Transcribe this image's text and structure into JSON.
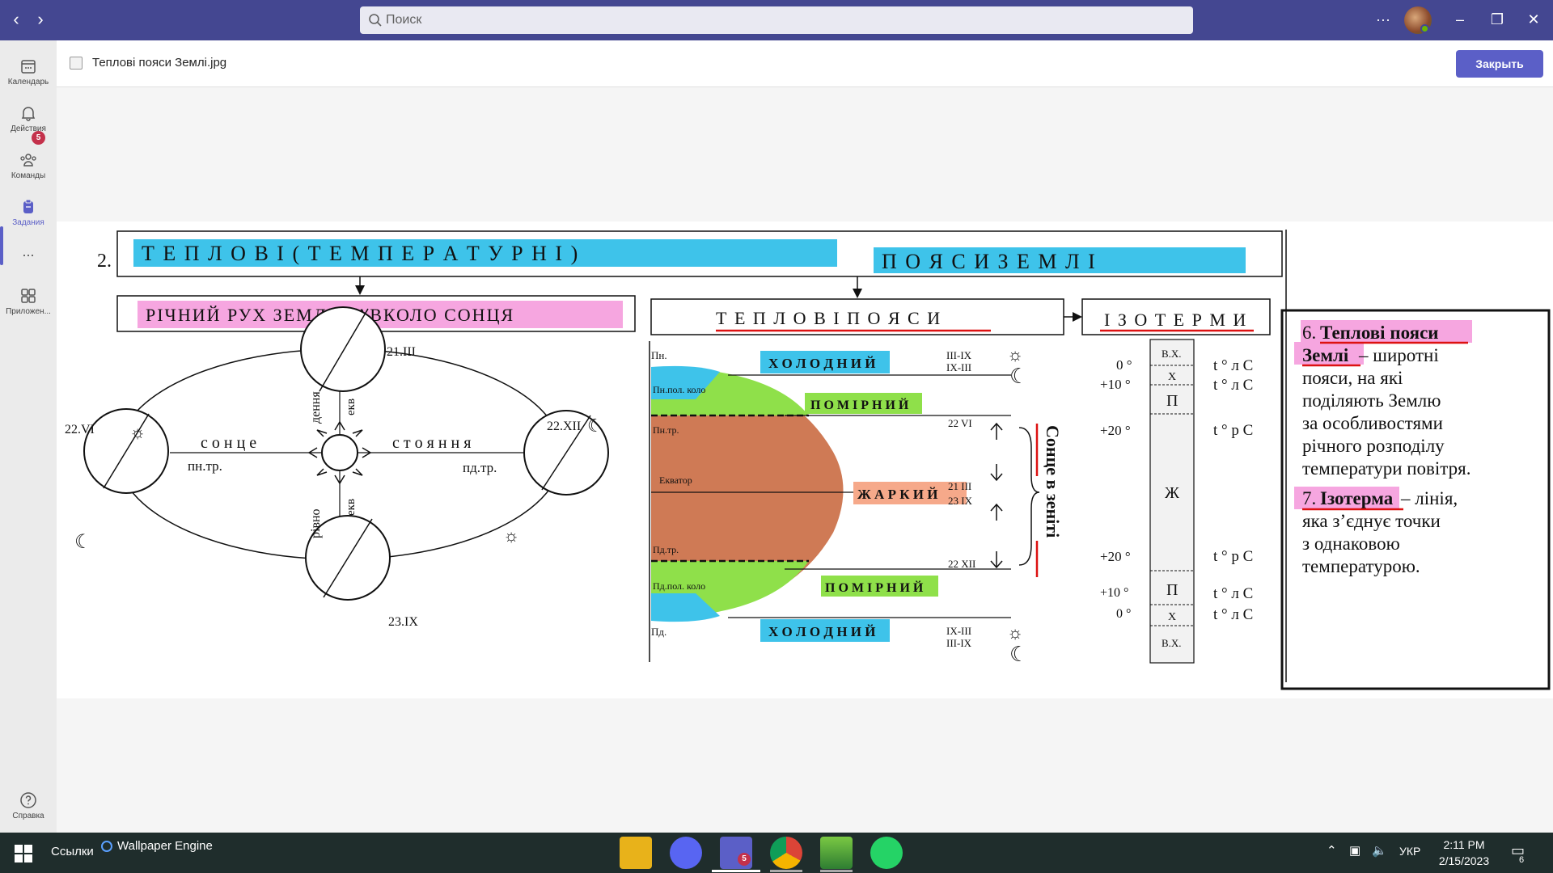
{
  "titlebar": {
    "search_placeholder": "Поиск",
    "more_icon": "more-horizontal-icon",
    "window_controls": [
      "minimize",
      "restore",
      "close"
    ]
  },
  "rail": {
    "items": [
      {
        "label": "Календарь",
        "icon": "calendar-icon"
      },
      {
        "label": "Действия",
        "icon": "bell-icon",
        "badge": "5"
      },
      {
        "label": "Команды",
        "icon": "teams-icon"
      },
      {
        "label": "Задания",
        "icon": "assignments-icon",
        "active": true
      },
      {
        "label": "...",
        "icon": "more-icon"
      },
      {
        "label": "Приложен...",
        "icon": "apps-icon"
      },
      {
        "label": "Справка",
        "icon": "help-icon"
      }
    ]
  },
  "file": {
    "name": "Теплові пояси Землі.jpg",
    "close_label": "Закрыть"
  },
  "image": {
    "number": "2.",
    "main_title_a": "Т Е П Л О В І   ( Т Е М П Е Р А Т У Р Н І )",
    "main_title_b": "П О Я С И   З Е М Л І",
    "box_left": "РІЧНИЙ РУХ ЗЕМЛІ НАВКОЛО СОНЦЯ",
    "box_mid": "Т Е П Л О В І   П О Я С И",
    "box_right": "І З О Т Е Р М И",
    "orbit": {
      "d_top": "21.III",
      "d_left": "22.VI",
      "d_right": "22.XII",
      "d_bottom": "23.IX",
      "sontse": "с о н ц е",
      "stoyannya": "с т о я н н я",
      "pn_tr": "пн.тр.",
      "pd_tr": "пд.тр.",
      "dennya": "дення",
      "rivno": "рівно",
      "ekv": "екв"
    },
    "zones": {
      "pn": "Пн.",
      "pn_pol": "Пн.пол. коло",
      "pn_tr": "Пн.тр.",
      "ekvator": "Екватор",
      "pd_tr": "Пд.тр.",
      "pd_pol": "Пд.пол. коло",
      "pd": "Пд.",
      "kholodnyi": "Х О Л О Д Н И Й",
      "pomirnyi": "П О М І Р Н И Й",
      "zharkyi": "Ж А Р К И Й",
      "dates_top": [
        "III-IX",
        "IX-III"
      ],
      "dates_bottom": [
        "IX-III",
        "III-IX"
      ],
      "d1": "22 VI",
      "d2": "21 III",
      "d3": "23 IX",
      "d4": "22 XII",
      "zenith": "Сонце в зеніті"
    },
    "isotherms": {
      "left_vals": [
        "0 °",
        "+10 °",
        "+20 °",
        "+20 °",
        "+10 °",
        "0 °"
      ],
      "col": [
        "В.Х.",
        "Х",
        "П",
        "Ж",
        "П",
        "Х",
        "В.Х."
      ],
      "right_vals": [
        "t ° л С",
        "t ° л С",
        "t ° р С",
        "t ° р С",
        "t ° л С",
        "t ° л С"
      ]
    },
    "definition": {
      "n6": "6.",
      "term6a": "Теплові пояси",
      "term6b": "Землі",
      "text6": [
        " – широтні",
        "пояси, на які",
        "поділяють Землю",
        "за особливостями",
        "річного розподілу",
        "температури повітря."
      ],
      "n7": "7.",
      "term7": "Ізотерма",
      "text7": [
        " – лінія,",
        "яка з’єднує точки",
        "з однаковою",
        "температурою."
      ]
    }
  },
  "taskbar": {
    "links_label": "Ссылки",
    "wallpaper_label": "Wallpaper Engine",
    "teams_badge": "5",
    "language": "УКР",
    "time": "2:11 PM",
    "date": "2/15/2023",
    "notifications": "6"
  }
}
